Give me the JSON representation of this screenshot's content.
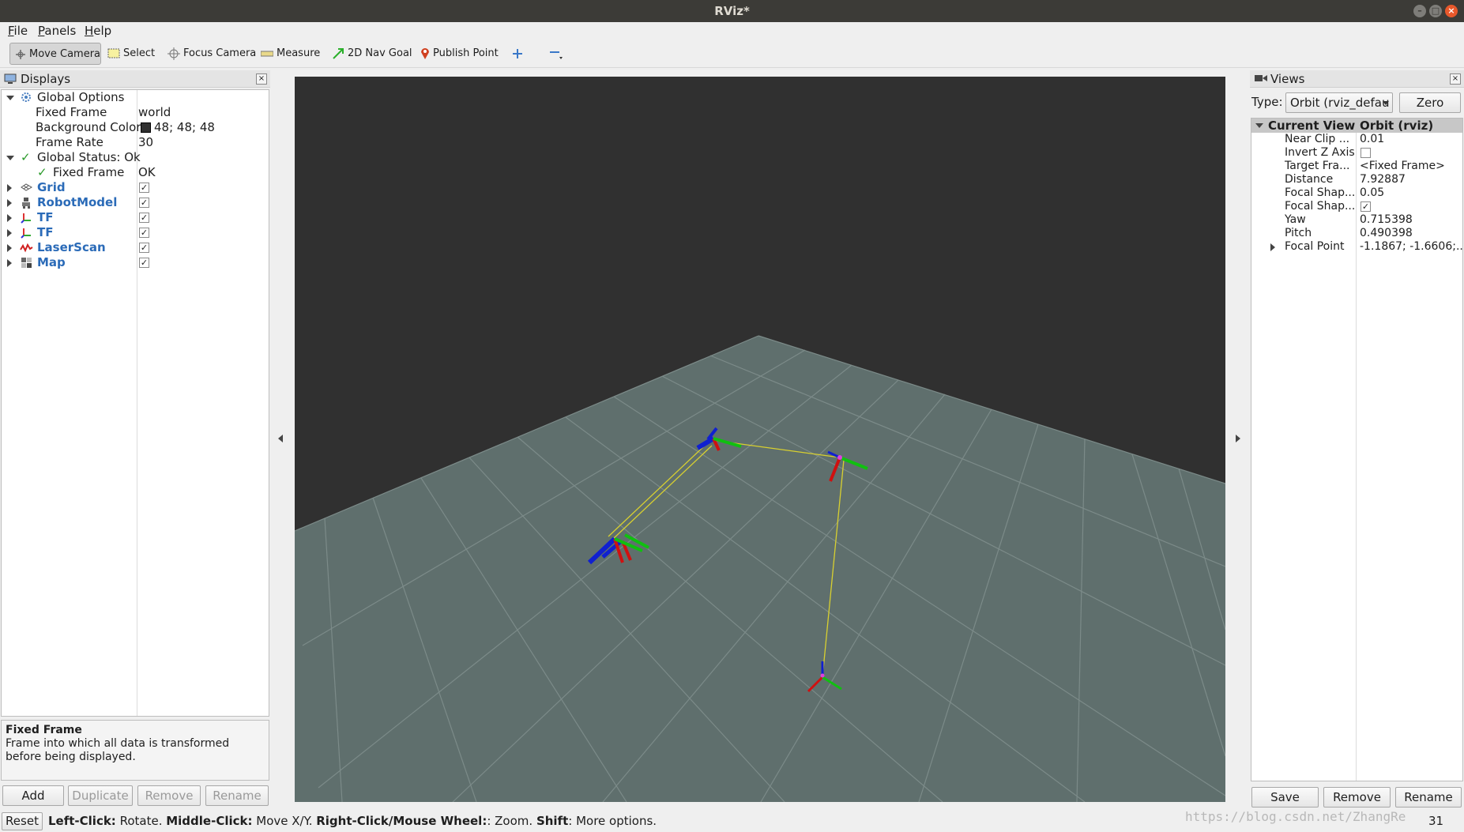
{
  "window": {
    "title": "RViz*"
  },
  "menu": [
    {
      "first": "F",
      "rest": "ile"
    },
    {
      "first": "P",
      "rest": "anels"
    },
    {
      "first": "H",
      "rest": "elp"
    }
  ],
  "toolbar": {
    "move_camera": "Move Camera",
    "select": "Select",
    "focus_camera": "Focus Camera",
    "measure": "Measure",
    "nav_goal": "2D Nav Goal",
    "publish_point": "Publish Point"
  },
  "displays": {
    "title": "Displays",
    "global_options": "Global Options",
    "fixed_frame_label": "Fixed Frame",
    "fixed_frame_value": "world",
    "background_color_label": "Background Color",
    "background_color_value": "48; 48; 48",
    "background_color_hex": "#303030",
    "frame_rate_label": "Frame Rate",
    "frame_rate_value": "30",
    "global_status": "Global Status: Ok",
    "status_fixed_frame_label": "Fixed Frame",
    "status_fixed_frame_value": "OK",
    "items": [
      {
        "label": "Grid",
        "icon": "grid-icon",
        "checked": true
      },
      {
        "label": "RobotModel",
        "icon": "robot-model-icon",
        "checked": true
      },
      {
        "label": "TF",
        "icon": "tf-icon",
        "checked": true
      },
      {
        "label": "TF",
        "icon": "tf-icon",
        "checked": true
      },
      {
        "label": "LaserScan",
        "icon": "laser-scan-icon",
        "checked": true
      },
      {
        "label": "Map",
        "icon": "map-icon",
        "checked": true
      }
    ],
    "desc_title": "Fixed Frame",
    "desc_body": "Frame into which all data is transformed before being displayed.",
    "buttons": {
      "add": "Add",
      "duplicate": "Duplicate",
      "remove": "Remove",
      "rename": "Rename"
    }
  },
  "views": {
    "title": "Views",
    "type_label": "Type:",
    "type_value": "Orbit (rviz_defau",
    "zero_button": "Zero",
    "header_name": "Current View",
    "header_value": "Orbit (rviz)",
    "props": [
      {
        "name": "Near Clip ...",
        "value": "0.01"
      },
      {
        "name": "Invert Z Axis",
        "value": "",
        "checkbox": true,
        "checked": false
      },
      {
        "name": "Target Fra...",
        "value": "<Fixed Frame>"
      },
      {
        "name": "Distance",
        "value": "7.92887"
      },
      {
        "name": "Focal Shap...",
        "value": "0.05"
      },
      {
        "name": "Focal Shap...",
        "value": "",
        "checkbox": true,
        "checked": true
      },
      {
        "name": "Yaw",
        "value": "0.715398"
      },
      {
        "name": "Pitch",
        "value": "0.490398"
      },
      {
        "name": "Focal Point",
        "value": "-1.1867; -1.6606;..."
      }
    ],
    "buttons": {
      "save": "Save",
      "remove": "Remove",
      "rename": "Rename"
    }
  },
  "status": {
    "reset": "Reset",
    "h1": "Left-Click:",
    "t1": " Rotate. ",
    "h2": "Middle-Click:",
    "t2": " Move X/Y. ",
    "h3": "Right-Click/Mouse Wheel:",
    "t3": ": Zoom. ",
    "h4": "Shift",
    "t4": ": More options.",
    "fps": "31 fps",
    "watermark": "https://blog.csdn.net/ZhangRe"
  },
  "colors": {
    "accent": "#2b6bb8",
    "grid_floor": "#5f6f6d",
    "axis_x": "#d01010",
    "axis_y": "#10c010",
    "axis_z": "#1020d0"
  }
}
